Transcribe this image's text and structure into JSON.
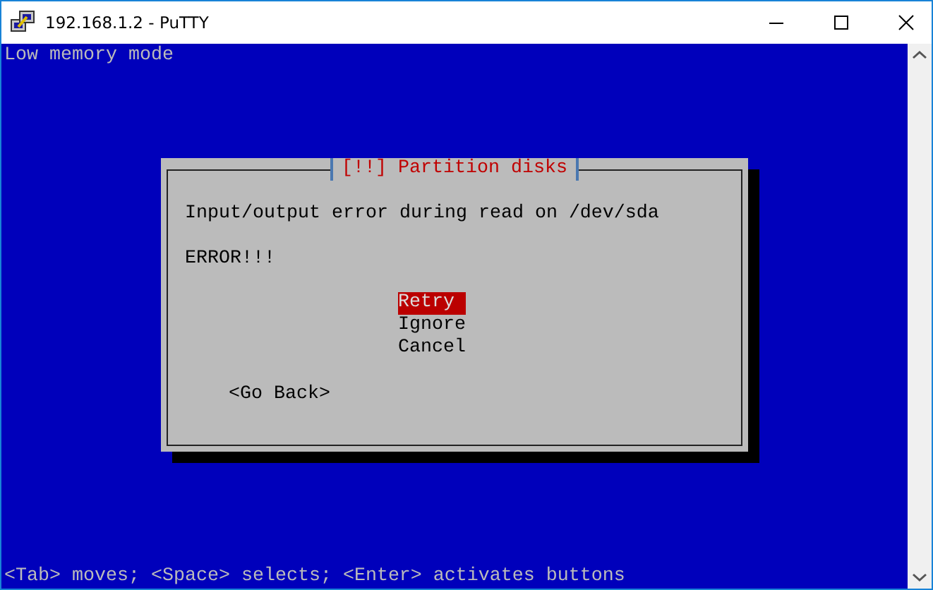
{
  "window": {
    "title": "192.168.1.2 - PuTTY"
  },
  "terminal": {
    "header_text": "Low memory mode",
    "status_text": "<Tab> moves; <Space> selects; <Enter> activates buttons"
  },
  "dialog": {
    "title": "[!!] Partition disks",
    "message": "Input/output error during read on /dev/sda",
    "error": "ERROR!!!",
    "options": [
      {
        "label": "Retry",
        "selected": true
      },
      {
        "label": "Ignore",
        "selected": false
      },
      {
        "label": "Cancel",
        "selected": false
      }
    ],
    "back_button": "<Go Back>"
  }
}
